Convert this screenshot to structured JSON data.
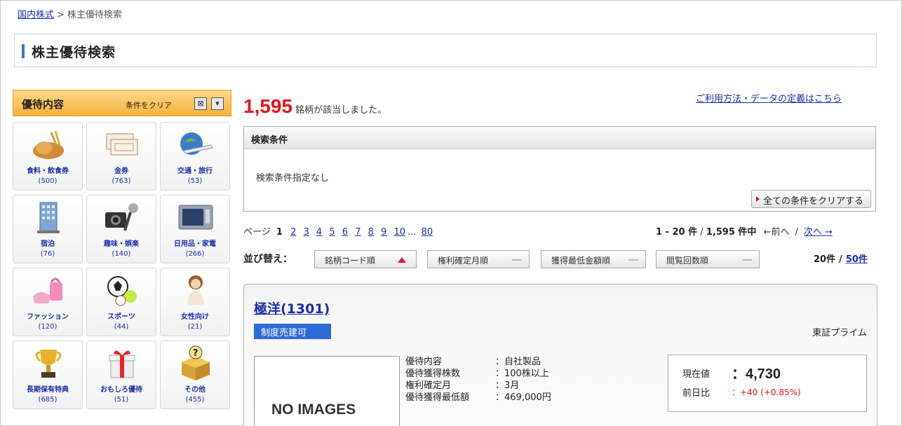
{
  "breadcrumb": {
    "home": "国内株式",
    "sep": ">",
    "current": "株主優待検索"
  },
  "page_title": "株主優待検索",
  "left_panel": {
    "title": "優待内容",
    "clear_label": "条件をクリア",
    "categories": [
      {
        "label": "食料・飲食券",
        "count": "(500)",
        "icon": "bread-icon"
      },
      {
        "label": "金券",
        "count": "(763)",
        "icon": "voucher-icon"
      },
      {
        "label": "交通・旅行",
        "count": "(53)",
        "icon": "airplane-icon"
      },
      {
        "label": "宿泊",
        "count": "(76)",
        "icon": "hotel-icon"
      },
      {
        "label": "趣味・娯楽",
        "count": "(140)",
        "icon": "camera-mic-icon"
      },
      {
        "label": "日用品・家電",
        "count": "(266)",
        "icon": "microwave-icon"
      },
      {
        "label": "ファッション",
        "count": "(120)",
        "icon": "fashion-bag-icon"
      },
      {
        "label": "スポーツ",
        "count": "(44)",
        "icon": "sports-ball-icon"
      },
      {
        "label": "女性向け",
        "count": "(21)",
        "icon": "woman-icon"
      },
      {
        "label": "長期保有特典",
        "count": "(685)",
        "icon": "trophy-icon"
      },
      {
        "label": "おもしろ優待",
        "count": "(51)",
        "icon": "gift-icon"
      },
      {
        "label": "その他",
        "count": "(455)",
        "icon": "question-box-icon"
      }
    ]
  },
  "results": {
    "count": "1,595",
    "count_suffix": "銘柄が該当しました。"
  },
  "help_link": "ご利用方法・データの定義はこちら",
  "conditions": {
    "heading": "検索条件",
    "body": "検索条件指定なし",
    "clear_all": "全ての条件をクリアする"
  },
  "pager": {
    "label": "ページ",
    "current": "1",
    "pages": [
      "2",
      "3",
      "4",
      "5",
      "6",
      "7",
      "8",
      "9",
      "10"
    ],
    "ellipsis": "...",
    "last": "80",
    "range_text": "1 - 20 件",
    "total_text": "1,595 件中",
    "prev": "←前へ",
    "next": "次へ →"
  },
  "sort": {
    "label": "並び替え：",
    "buttons": [
      "銘柄コード順",
      "権利確定月順",
      "獲得最低金額順",
      "閲覧回数順"
    ]
  },
  "per_page": {
    "current": "20件",
    "other": "50件"
  },
  "stock": {
    "name": "極洋(1301)",
    "badge": "制度売建可",
    "market": "東証プライム",
    "no_image": "NO IMAGES",
    "info": [
      {
        "key": "優待内容",
        "value": "：自社製品"
      },
      {
        "key": "優待獲得株数",
        "value": "：100株以上"
      },
      {
        "key": "権利確定月",
        "value": "：3月"
      },
      {
        "key": "優待獲得最低額",
        "value": "：469,000円"
      }
    ],
    "price_label": "現在値",
    "price_value": "：4,730",
    "change_label": "前日比",
    "change_value": "：+40 (+0.85%)"
  },
  "colors": {
    "accent_red": "#e0181e",
    "link_blue": "#1a2fa8",
    "header_orange": "#f7b13c",
    "badge_blue": "#2f6bd6"
  }
}
